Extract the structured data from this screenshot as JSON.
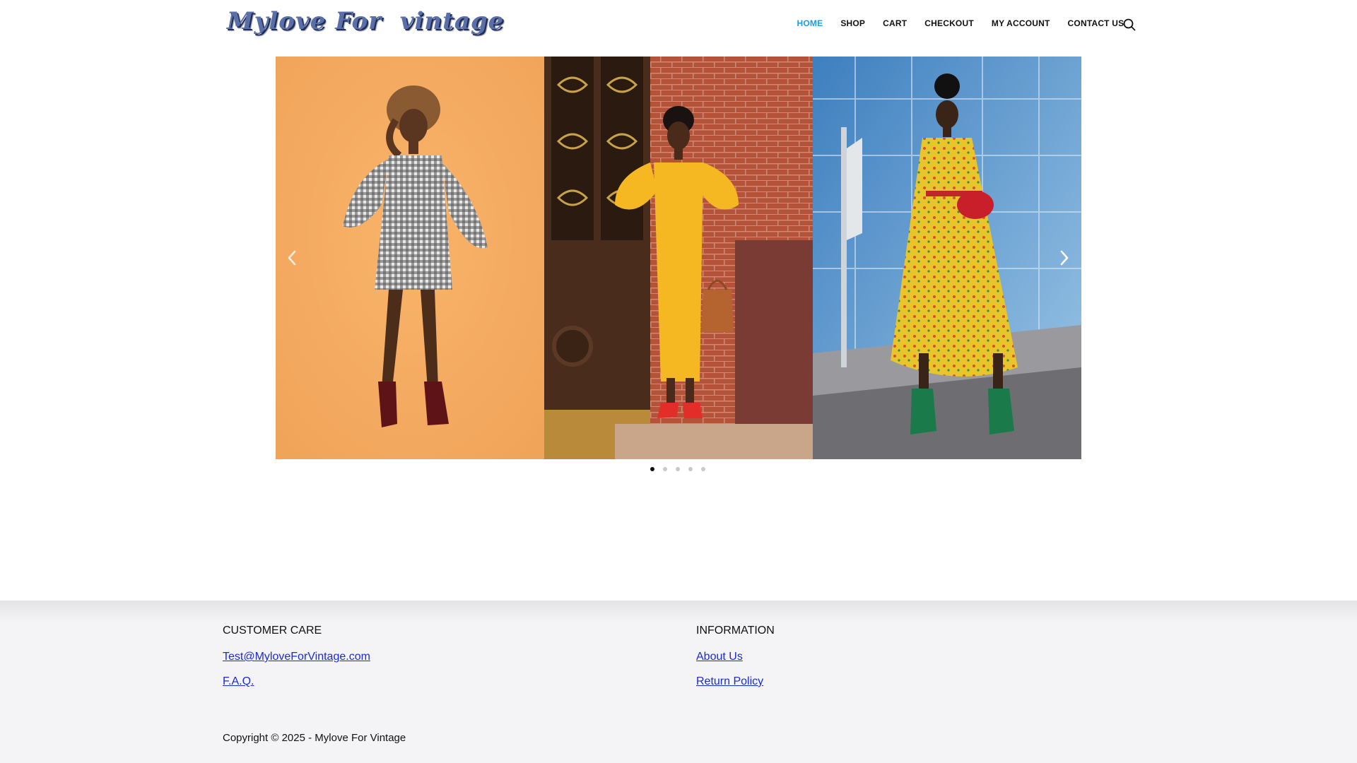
{
  "header": {
    "logo_text": "Mylove For  vintage",
    "nav": [
      {
        "label": "HOME",
        "active": true
      },
      {
        "label": "SHOP",
        "active": false
      },
      {
        "label": "CART",
        "active": false
      },
      {
        "label": "CHECKOUT",
        "active": false
      },
      {
        "label": "MY ACCOUNT",
        "active": false
      },
      {
        "label": "CONTACT US",
        "active": false
      }
    ],
    "search_icon": "search-icon",
    "accent_color": "#1b9ee8"
  },
  "slider": {
    "slides": [
      {
        "subject": "gingham-dress-orange-backdrop"
      },
      {
        "subject": "yellow-ruffle-dress-brick-doorway"
      },
      {
        "subject": "yellow-floral-dress-city"
      }
    ],
    "prev_icon": "chevron-left-icon",
    "next_icon": "chevron-right-icon",
    "dot_count": 5,
    "active_dot": 0
  },
  "footer": {
    "customer_care": {
      "heading": "CUSTOMER CARE",
      "links": [
        "Test@MyloveForVintage.com",
        "F.A.Q."
      ]
    },
    "information": {
      "heading": "INFORMATION",
      "links": [
        "About Us",
        "Return Policy"
      ]
    },
    "copyright": "Copyright © 2025 - Mylove For Vintage",
    "link_color": "#1a2ad6"
  }
}
